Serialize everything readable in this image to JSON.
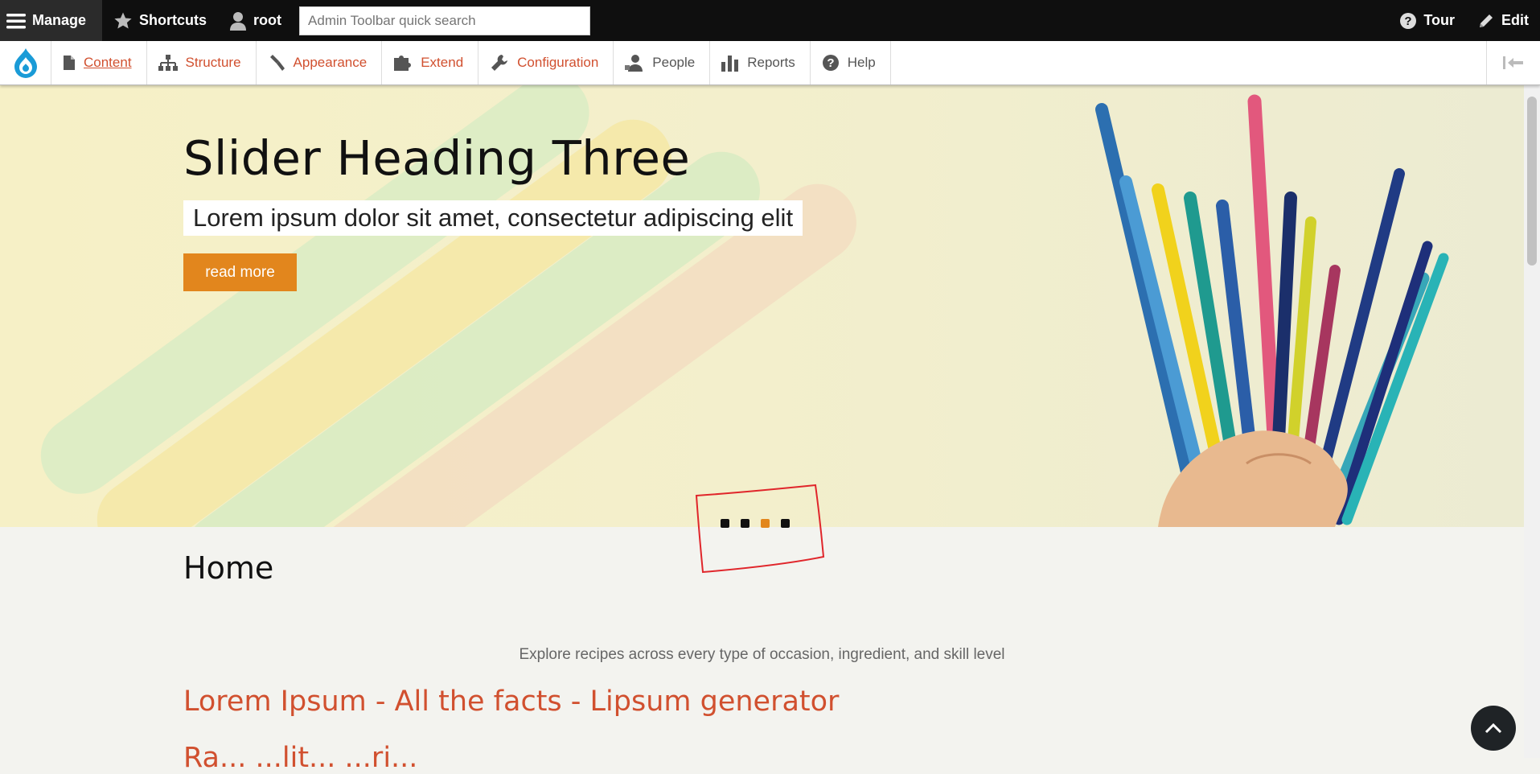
{
  "toolbar": {
    "manage": "Manage",
    "shortcuts": "Shortcuts",
    "user": "root",
    "search_placeholder": "Admin Toolbar quick search",
    "tour": "Tour",
    "edit": "Edit"
  },
  "tray": {
    "items": [
      {
        "label": "Content",
        "icon": "file-icon"
      },
      {
        "label": "Structure",
        "icon": "sitemap-icon"
      },
      {
        "label": "Appearance",
        "icon": "paintbrush-icon"
      },
      {
        "label": "Extend",
        "icon": "puzzle-icon"
      },
      {
        "label": "Configuration",
        "icon": "wrench-icon"
      },
      {
        "label": "People",
        "icon": "person-icon"
      },
      {
        "label": "Reports",
        "icon": "bar-chart-icon"
      },
      {
        "label": "Help",
        "icon": "question-icon"
      }
    ]
  },
  "hero": {
    "title": "Slider Heading Three",
    "subtitle": "Lorem ipsum dolor sit amet, consectetur adipiscing elit",
    "button": "read more",
    "slide_count": 4,
    "active_slide": 3
  },
  "main": {
    "page_title": "Home",
    "tagline": "Explore recipes across every type of occasion, ingredient, and skill level",
    "article_link": "Lorem Ipsum - All the facts - Lipsum generator",
    "article_link_partial": "Ra... ...lit... ...ri..."
  },
  "colors": {
    "accent": "#e2861d",
    "link": "#d1502f",
    "toolbar": "#0f0f0f",
    "annotation": "#e0262b"
  }
}
